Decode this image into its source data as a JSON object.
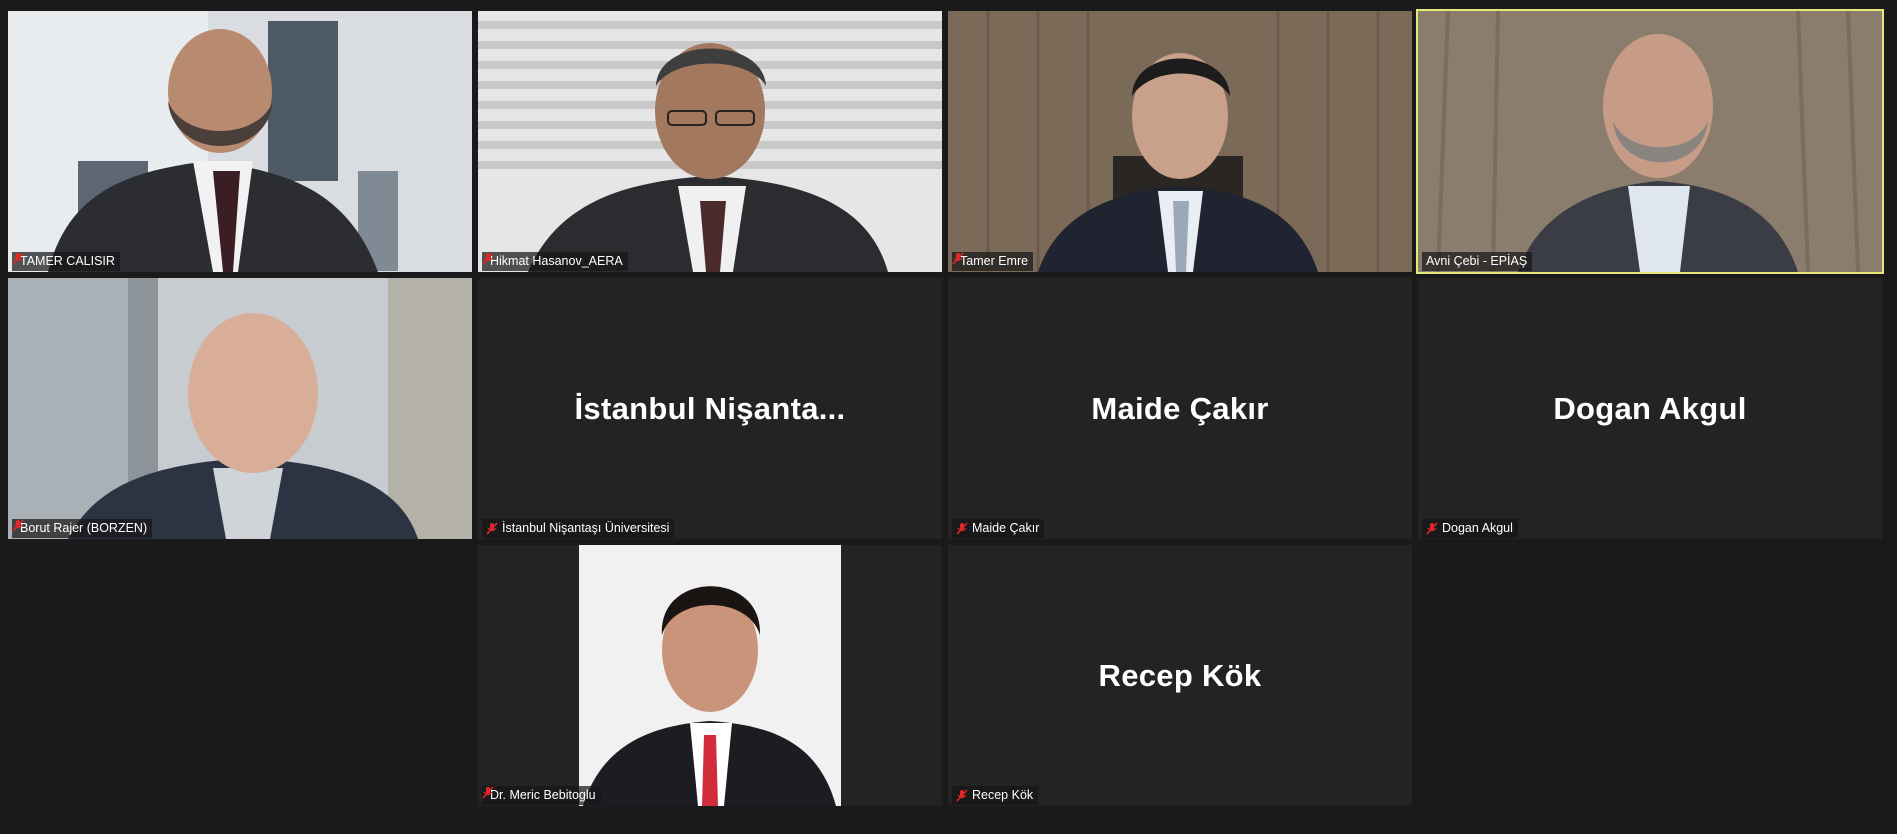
{
  "meeting": {
    "participants": [
      {
        "name": "TAMER CALISIR",
        "video": true,
        "active": false,
        "muted": true
      },
      {
        "name": "Hikmat Hasanov_AERA",
        "video": true,
        "active": false,
        "muted": true
      },
      {
        "name": "Tamer Emre",
        "video": true,
        "active": false,
        "muted": true
      },
      {
        "name": "Avni Çebi - EPİAŞ",
        "video": true,
        "active": true,
        "muted": false
      },
      {
        "name": "Borut Rajer (BORZEN)",
        "video": true,
        "active": false,
        "muted": true
      },
      {
        "name": "İstanbul Nişantaşı Üniversitesi",
        "display_name": "İstanbul  Nişanta...",
        "video": false,
        "active": false,
        "muted": true
      },
      {
        "name": "Maide Çakır",
        "display_name": "Maide Çakır",
        "video": false,
        "active": false,
        "muted": true
      },
      {
        "name": "Dogan Akgul",
        "display_name": "Dogan Akgul",
        "video": false,
        "active": false,
        "muted": true
      },
      {
        "name": "Dr. Meric Bebitoglu",
        "video": true,
        "active": false,
        "muted": true
      },
      {
        "name": "Recep Kök",
        "display_name": "Recep Kök",
        "video": false,
        "active": false,
        "muted": true
      }
    ]
  },
  "colors": {
    "background": "#1a1a1a",
    "tile": "#232323",
    "active_speaker_border": "#e6e87a",
    "muted_icon": "#e02828"
  },
  "icons": {
    "muted": "microphone-muted-icon"
  }
}
